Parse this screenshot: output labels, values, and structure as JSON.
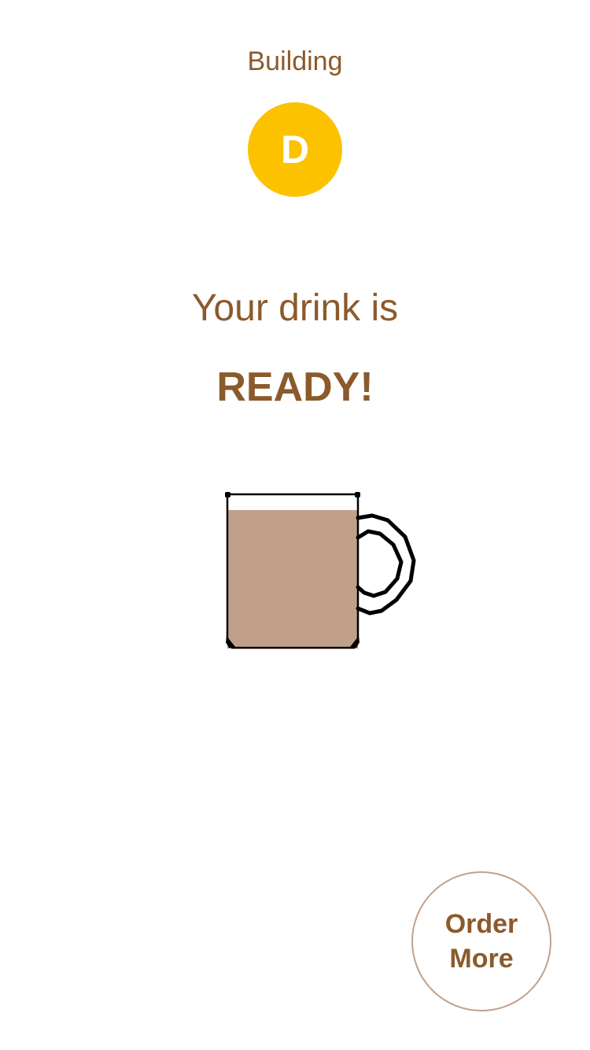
{
  "header": {
    "label": "Building",
    "badge_letter": "D",
    "badge_color": "#fcc200"
  },
  "status": {
    "line": "Your drink is",
    "emphasis": "READY!"
  },
  "illustration": {
    "icon": "coffee-mug-icon",
    "liquid_color": "#c1a08a"
  },
  "actions": {
    "order_more_label": "Order More"
  },
  "colors": {
    "text": "#8b5a2b",
    "button_border": "#c4a088"
  }
}
